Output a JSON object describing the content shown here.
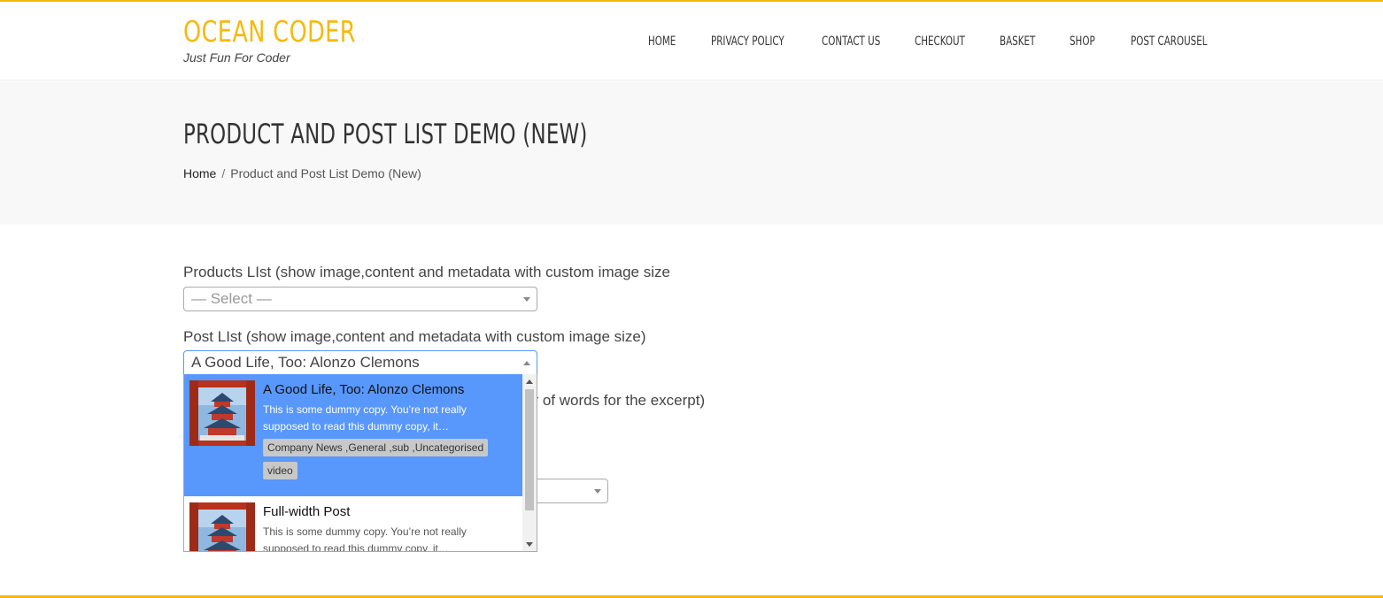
{
  "site": {
    "title": "OCEAN CODER",
    "tagline": "Just Fun For Coder",
    "accent_color": "#f5b90c"
  },
  "nav": {
    "items": [
      {
        "label": "HOME"
      },
      {
        "label": "PRIVACY POLICY"
      },
      {
        "label": "CONTACT US"
      },
      {
        "label": "CHECKOUT"
      },
      {
        "label": "BASKET"
      },
      {
        "label": "SHOP"
      },
      {
        "label": "POST CAROUSEL"
      }
    ]
  },
  "page": {
    "title": "PRODUCT AND POST LIST DEMO (NEW)",
    "breadcrumb": {
      "home": "Home",
      "separator": "/",
      "current": "Product and Post List Demo (New)"
    }
  },
  "form": {
    "products_label": "Products LIst (show image,content and metadata with custom image size",
    "products_placeholder": "— Select —",
    "post_label": "Post LIst (show image,content and metadata with custom image size)",
    "post_selected": "A Good Life, Too: Alonzo Clemons",
    "partially_hidden_text": "er of words for the excerpt)"
  },
  "dropdown": {
    "highlight_color": "#5897fb",
    "items": [
      {
        "title": "A Good Life, Too: Alonzo Clemons",
        "excerpt": "This is some dummy copy. You’re not really supposed to read this dummy copy, it…",
        "tags": [
          "Company News ,General ,sub ,Uncategorised",
          "video"
        ],
        "thumbnail": "temple-image"
      },
      {
        "title": "Full-width Post",
        "excerpt": "This is some dummy copy. You’re not really supposed to read this dummy copy, it…",
        "tags": [],
        "thumbnail": "temple-image"
      }
    ]
  }
}
